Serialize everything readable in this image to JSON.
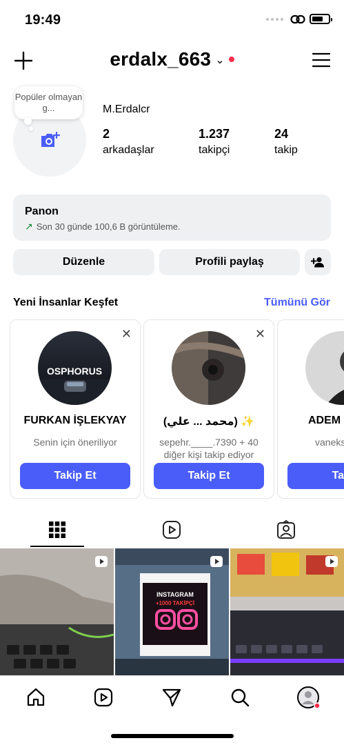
{
  "status_bar": {
    "time": "19:49"
  },
  "header": {
    "username": "erdalx_663",
    "chevron": "⌄"
  },
  "profile": {
    "note": "Popüler olmayan g...",
    "full_name": "M.Erdalcr",
    "stats": [
      {
        "value": "2",
        "label": "arkadaşlar"
      },
      {
        "value": "1.237",
        "label": "takipçi"
      },
      {
        "value": "24",
        "label": "takip"
      }
    ]
  },
  "dashboard": {
    "title": "Panon",
    "subtitle": "Son 30 günde 100,6 B görüntüleme."
  },
  "actions": {
    "edit": "Düzenle",
    "share": "Profili paylaş"
  },
  "suggestions": {
    "title": "Yeni İnsanlar Keşfet",
    "see_all": "Tümünü Gör",
    "cards": [
      {
        "name": "FURKAN İŞLEKYAY",
        "subtitle": "Senin için öneriliyor",
        "button": "Takip Et",
        "avatar_text": "OSPHORUS"
      },
      {
        "name": "(محمد ... علي) ✨",
        "subtitle": "sepehr.____.7390 + 40 diğer kişi takip ediyor",
        "button": "Takip Et",
        "avatar_text": ""
      },
      {
        "name": "ADEM",
        "subtitle": "vaneks takip e",
        "button": "Taki",
        "avatar_text": ""
      }
    ]
  },
  "grid": {
    "tiles": [
      {
        "caption": ""
      },
      {
        "caption_top": "INSTAGRAM",
        "caption_bottom": "+1000 TAKİPÇİ"
      },
      {
        "caption": ""
      }
    ]
  },
  "colors": {
    "accent": "#4a5df9",
    "notification": "#ff2e4c",
    "trend": "#1a8a3a"
  }
}
